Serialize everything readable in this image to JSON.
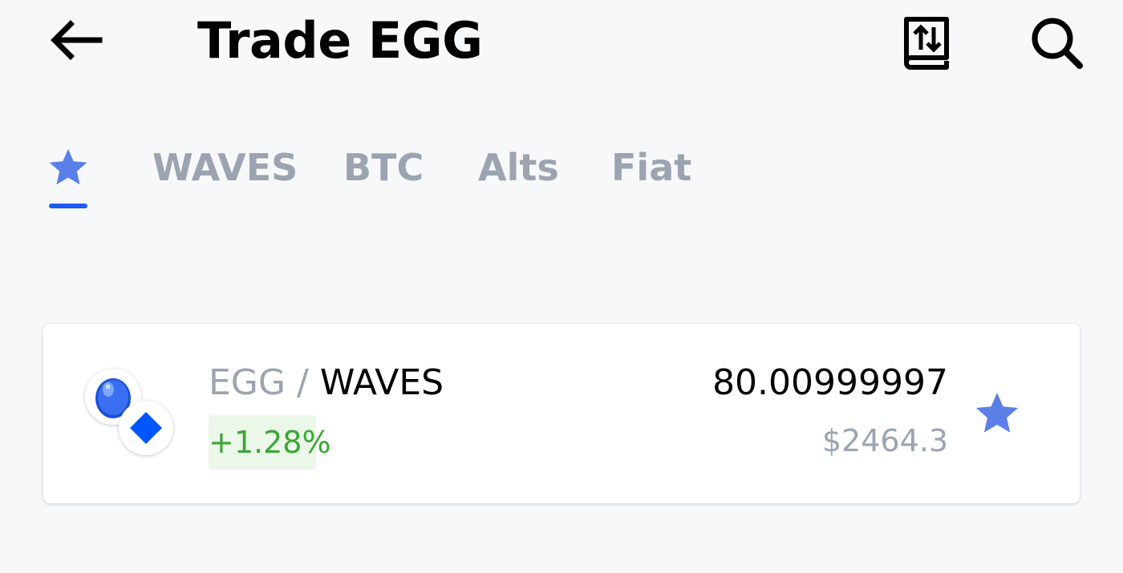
{
  "header": {
    "title": "Trade EGG",
    "back_icon": "arrow-left-icon",
    "history_icon": "trade-history-icon",
    "search_icon": "search-icon"
  },
  "tabs": [
    {
      "label": "",
      "icon": "star-icon",
      "active": true
    },
    {
      "label": "WAVES",
      "active": false
    },
    {
      "label": "BTC",
      "active": false
    },
    {
      "label": "Alts",
      "active": false
    },
    {
      "label": "Fiat",
      "active": false
    }
  ],
  "pairs": [
    {
      "base": "EGG",
      "separator": "/",
      "quote": "WAVES",
      "change": "+1.28%",
      "price": "80.00999997",
      "usd_price": "$2464.3",
      "favorite": true
    }
  ],
  "colors": {
    "accent": "#1f5af6",
    "star": "#5b7fe8",
    "positive": "#3aa735",
    "muted": "#9ba4b0"
  }
}
